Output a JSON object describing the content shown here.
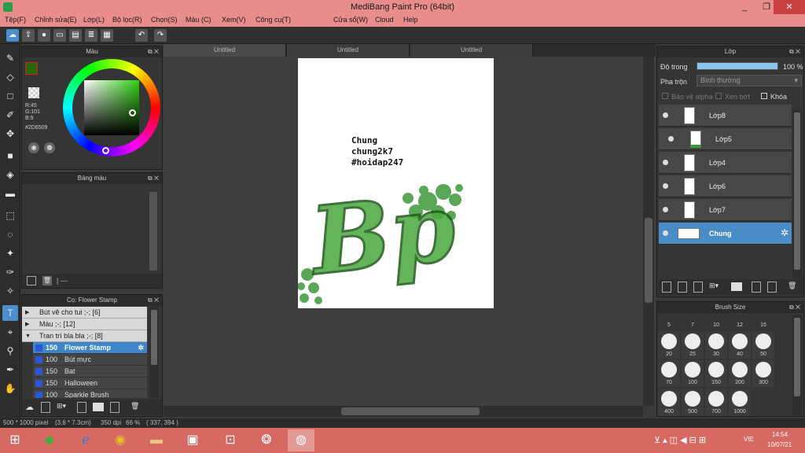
{
  "window": {
    "title": "MediBang Paint Pro (64bit)",
    "minimize": "_",
    "maximize": "❐",
    "close": "✕"
  },
  "menu": [
    "Tệp(F)",
    "Chỉnh sửa(E)",
    "Lớp(L)",
    "Bộ lọc(R)",
    "Chọn(S)",
    "Màu (C)",
    "Xem(V)",
    "Công cụ(T)",
    "Cửa sổ(W)",
    "Cloud",
    "Help"
  ],
  "tabs": [
    "Untitled",
    "Untitled",
    "Untitled"
  ],
  "color_panel": {
    "title": "Màu",
    "r": "R:45",
    "g": "G:101",
    "b": "B:9",
    "hex": "#2D6509",
    "fg_color": "#2D6509"
  },
  "palette_panel": {
    "title": "Bảng màu",
    "swatches": [
      "#5a2a22",
      "#6f3a2e",
      "#8a4a3a",
      "#9a5a48",
      "#a66a58",
      "#804030",
      "#6a2e24",
      "#5a2820",
      "#3c7a2e",
      "#5a9a3c",
      "#e8e0c8",
      "#f2e6c8",
      "#e8c090",
      "#d89a70",
      "#c88060"
    ],
    "extra": "#c98a6e",
    "footer": "| ---"
  },
  "brush_panel": {
    "title": "Cọ: Flower Stamp",
    "groups": [
      {
        "arrow": "▶",
        "label": "Bút vẽ cho tui ;-; [6]"
      },
      {
        "arrow": "▶",
        "label": "Màu ;-; [12]"
      },
      {
        "arrow": "▼",
        "label": "Tran trí bla bla ;-; [8]"
      }
    ],
    "items": [
      {
        "size": "150",
        "name": "Flower Stamp"
      },
      {
        "size": "100",
        "name": "Bút mực"
      },
      {
        "size": "150",
        "name": "Bat"
      },
      {
        "size": "150",
        "name": "Halloween"
      },
      {
        "size": "100",
        "name": "Sparkle Brush"
      }
    ]
  },
  "canvas_text": [
    "Chung",
    "chung2k7",
    "#hoidap247"
  ],
  "canvas_logo_text": "Bp",
  "layer_panel": {
    "title": "Lớp",
    "opacity_label": "Độ trong",
    "opacity_value": "100 %",
    "opacity_percent": 100,
    "blend_label": "Pha trộn",
    "blend_value": "Bình thường",
    "protect_alpha": "Bảo vệ alpha",
    "clipping": "Xén bớt",
    "lock": "Khóa",
    "layers": [
      {
        "name": "Lớp8",
        "indent": false,
        "selected": false
      },
      {
        "name": "Lớp5",
        "indent": true,
        "selected": false
      },
      {
        "name": "Lớp4",
        "indent": false,
        "selected": false
      },
      {
        "name": "Lớp6",
        "indent": false,
        "selected": false
      },
      {
        "name": "Lớp7",
        "indent": false,
        "selected": false
      },
      {
        "name": "Chung",
        "indent": false,
        "selected": true
      }
    ]
  },
  "brush_size_panel": {
    "title": "Brush Size",
    "top_row": [
      "5",
      "7",
      "10",
      "12",
      "15"
    ],
    "rows": [
      [
        "20",
        "25",
        "30",
        "40",
        "50"
      ],
      [
        "70",
        "100",
        "150",
        "200",
        "300"
      ],
      [
        "400",
        "500",
        "700",
        "1000"
      ]
    ]
  },
  "status": {
    "dimensions": "500 * 1000 pixel",
    "size_cm": "(3.6 * 7.3cm)",
    "dpi": "350 dpi",
    "zoom": "66 %",
    "cursor": "( 337, 394 )"
  },
  "taskbar": {
    "lang": "VIE",
    "time": "14:54",
    "date": "10/07/21"
  }
}
